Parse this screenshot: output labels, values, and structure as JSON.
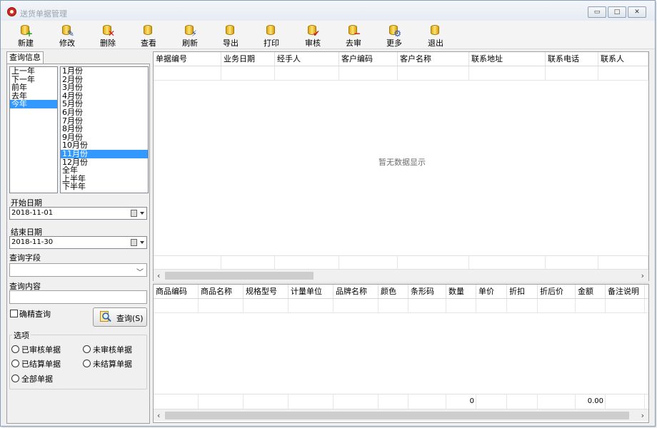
{
  "window": {
    "title": "送货单据管理",
    "controls": {
      "minimize": "▭",
      "maximize": "□",
      "close": "✕"
    }
  },
  "toolbar": [
    {
      "label": "新建",
      "icon": "new-icon",
      "overlay": "+",
      "overlay_color": "#2e9a1e"
    },
    {
      "label": "修改",
      "icon": "edit-icon",
      "overlay": "✎",
      "overlay_color": "#2456b3"
    },
    {
      "label": "删除",
      "icon": "delete-icon",
      "overlay": "✕",
      "overlay_color": "#d01a1a"
    },
    {
      "label": "查看",
      "icon": "view-icon",
      "overlay": "",
      "overlay_color": "#2456b3"
    },
    {
      "label": "刷新",
      "icon": "refresh-icon",
      "overlay": "⚡",
      "overlay_color": "#2456b3"
    },
    {
      "label": "导出",
      "icon": "export-icon",
      "overlay": "",
      "overlay_color": "#1d7d3a"
    },
    {
      "label": "打印",
      "icon": "print-icon",
      "overlay": "",
      "overlay_color": "#2456b3"
    },
    {
      "label": "审核",
      "icon": "approve-icon",
      "overlay": "✔",
      "overlay_color": "#d01a1a"
    },
    {
      "label": "去审",
      "icon": "unapprove-icon",
      "overlay": "−",
      "overlay_color": "#d01a1a"
    },
    {
      "label": "更多",
      "icon": "more-icon",
      "overlay": "⚙",
      "overlay_color": "#2456b3"
    },
    {
      "label": "退出",
      "icon": "exit-icon",
      "overlay": "",
      "overlay_color": "#d01a1a"
    }
  ],
  "query_panel": {
    "tab_label": "查询信息",
    "years": [
      "上一年",
      "下一年",
      "前年",
      "去年",
      "今年"
    ],
    "selected_year": "今年",
    "periods": [
      "1月份",
      "2月份",
      "3月份",
      "4月份",
      "5月份",
      "6月份",
      "7月份",
      "8月份",
      "9月份",
      "10月份",
      "11月份",
      "12月份",
      "全年",
      "上半年",
      "下半年"
    ],
    "selected_period": "11月份",
    "start_date_label": "开始日期",
    "start_date": "2018-11-01",
    "end_date_label": "结束日期",
    "end_date": "2018-11-30",
    "field_label": "查询字段",
    "field_value": "",
    "content_label": "查询内容",
    "content_value": "",
    "exact_label": "确精查询",
    "exact_checked": false,
    "query_button": "查询(S)",
    "options_title": "选项",
    "options": [
      "已审核单据",
      "未审核单据",
      "已结算单据",
      "未结算单据",
      "全部单据"
    ]
  },
  "main_grid": {
    "columns": [
      "单据编号",
      "业务日期",
      "经手人",
      "客户编码",
      "客户名称",
      "联系地址",
      "联系电话",
      "联系人"
    ],
    "empty_message": "暂无数据显示"
  },
  "detail_grid": {
    "columns": [
      "商品编码",
      "商品名称",
      "规格型号",
      "计量单位",
      "品牌名称",
      "颜色",
      "条形码",
      "数量",
      "单价",
      "折扣",
      "折后价",
      "金额",
      "备注说明"
    ],
    "totals": {
      "quantity": "0",
      "amount": "0.00"
    }
  },
  "colors": {
    "selection": "#3399ff",
    "close_icon": "#d02a1e"
  }
}
